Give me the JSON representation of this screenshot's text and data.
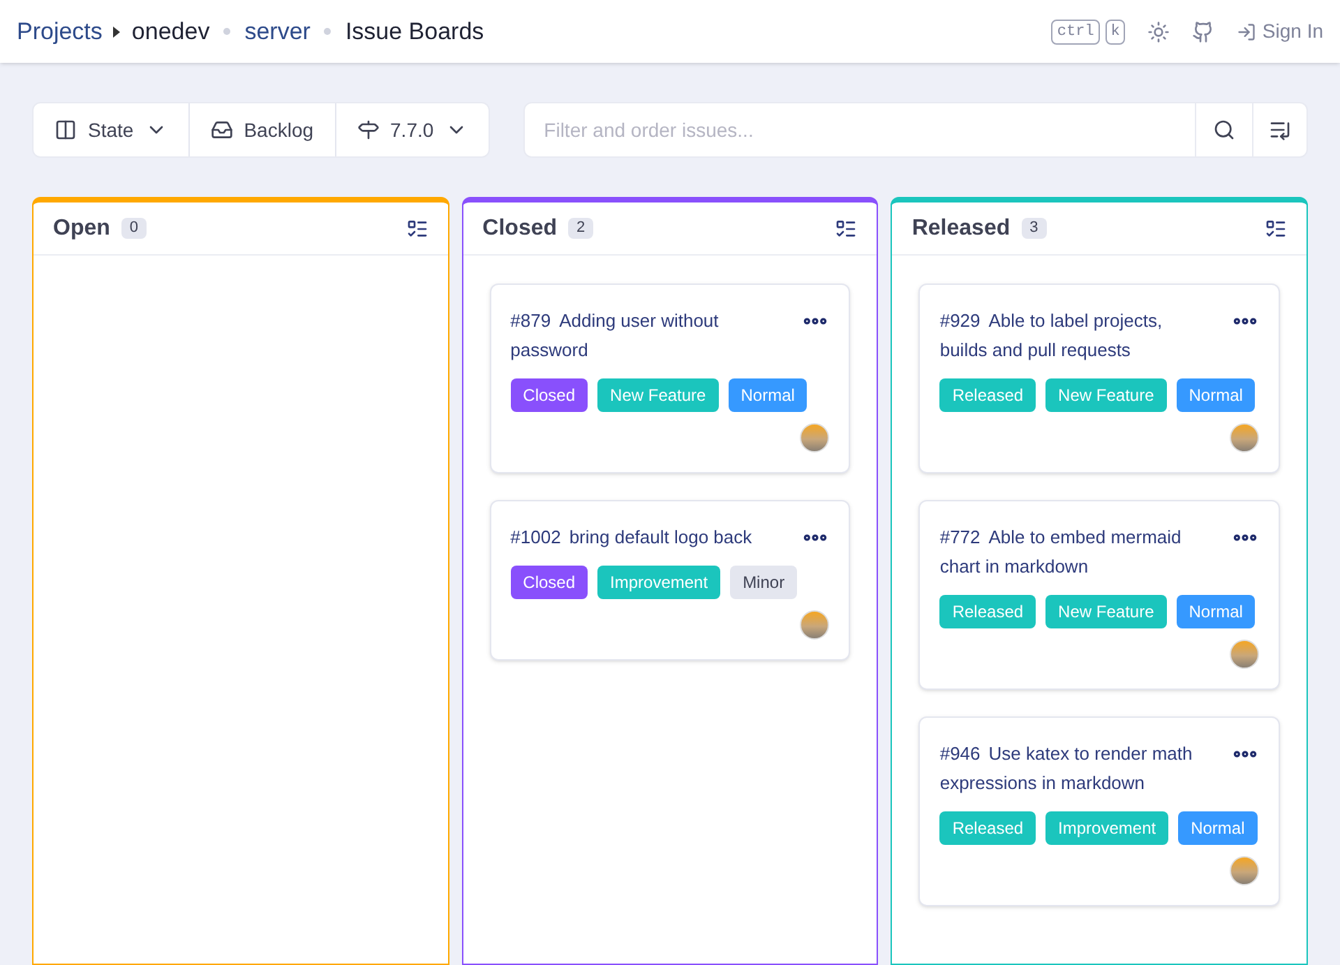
{
  "breadcrumb": [
    {
      "text": "Projects",
      "link": true
    },
    {
      "text": "onedev",
      "link": false
    },
    {
      "text": "server",
      "link": true
    },
    {
      "text": "Issue Boards",
      "link": false
    }
  ],
  "header": {
    "keys": [
      "ctrl",
      "k"
    ],
    "sign_in": "Sign In"
  },
  "toolbar": {
    "buttons": [
      {
        "label": "State",
        "dropdown": true
      },
      {
        "label": "Backlog",
        "dropdown": false
      },
      {
        "label": "7.7.0",
        "dropdown": true
      }
    ],
    "filter": {
      "placeholder": "Filter and order issues..."
    }
  },
  "columns": [
    {
      "title": "Open",
      "count": "0",
      "color": "#ffa800"
    },
    {
      "title": "Closed",
      "count": "2",
      "color": "#8950fc",
      "cards": [
        {
          "number": "#879",
          "title": "Adding user without password",
          "tags": [
            {
              "text": "Closed",
              "color": "#8950fc"
            },
            {
              "text": "New Feature",
              "color": "#1bc5bd"
            },
            {
              "text": "Normal",
              "color": "#3699ff"
            }
          ]
        },
        {
          "number": "#1002",
          "title": "bring default logo back",
          "tags": [
            {
              "text": "Closed",
              "color": "#8950fc"
            },
            {
              "text": "Improvement",
              "color": "#1bc5bd"
            },
            {
              "text": "Minor",
              "color": "#e4e6ef"
            }
          ]
        }
      ]
    },
    {
      "title": "Released",
      "count": "3",
      "color": "#1bc5bd",
      "cards": [
        {
          "number": "#929",
          "title": "Able to label projects, builds and pull requests",
          "tags": [
            {
              "text": "Released",
              "color": "#1bc5bd"
            },
            {
              "text": "New Feature",
              "color": "#1bc5bd"
            },
            {
              "text": "Normal",
              "color": "#3699ff"
            }
          ]
        },
        {
          "number": "#772",
          "title": "Able to embed mermaid chart in markdown",
          "tags": [
            {
              "text": "Released",
              "color": "#1bc5bd"
            },
            {
              "text": "New Feature",
              "color": "#1bc5bd"
            },
            {
              "text": "Normal",
              "color": "#3699ff"
            }
          ]
        },
        {
          "number": "#946",
          "title": "Use katex to render math expressions in markdown",
          "tags": [
            {
              "text": "Released",
              "color": "#1bc5bd"
            },
            {
              "text": "Improvement",
              "color": "#1bc5bd"
            },
            {
              "text": "Normal",
              "color": "#3699ff"
            }
          ]
        }
      ]
    }
  ]
}
